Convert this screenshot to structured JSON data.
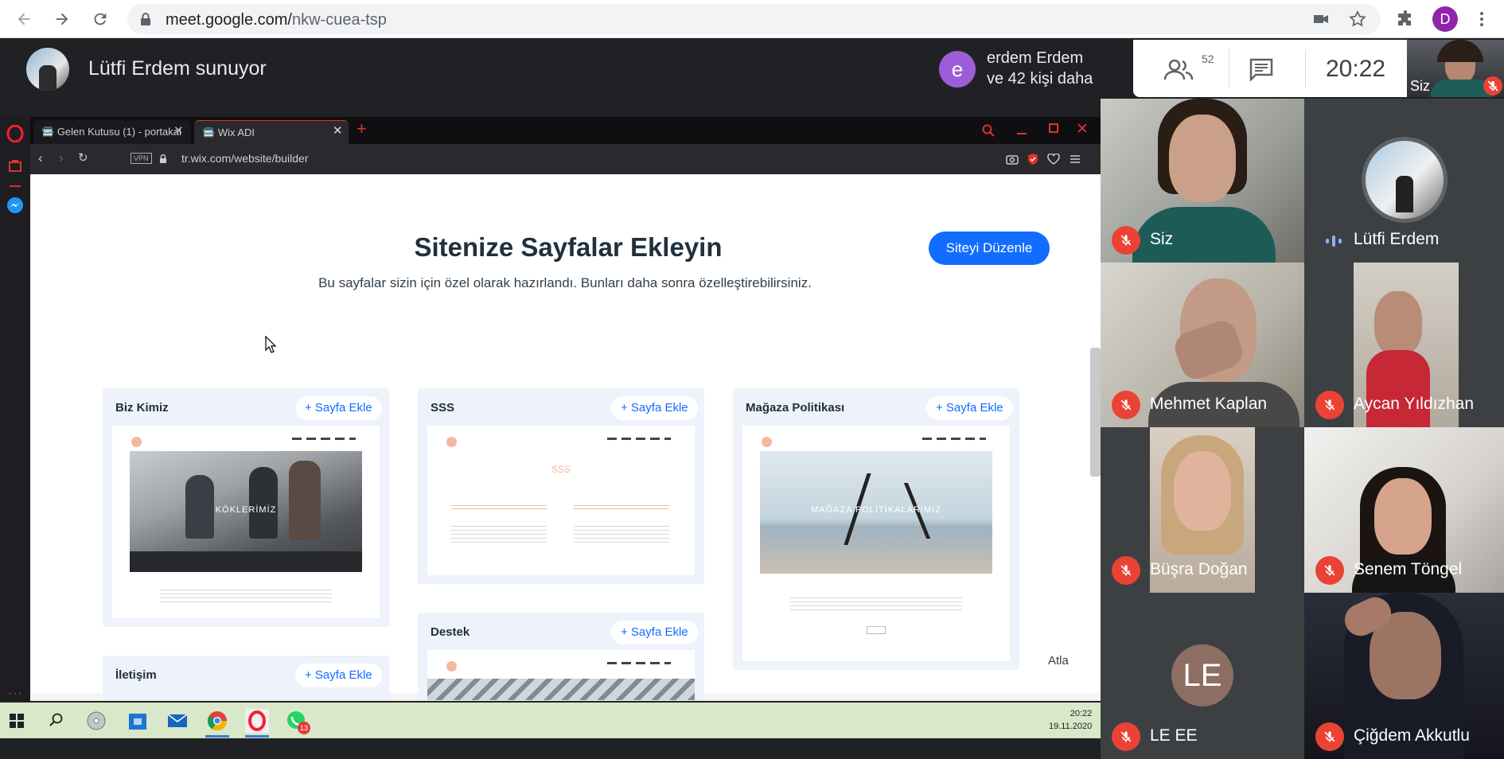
{
  "browser": {
    "url_host": "meet.google.com/",
    "url_path": "nkw-cuea-tsp",
    "profile_initial": "D"
  },
  "meet": {
    "presenter_title": "Lütfi Erdem sunuyor",
    "join_toast": {
      "avatar_letter": "e",
      "line1": "erdem Erdem",
      "line2": "ve 42 kişi daha"
    },
    "people_count": "52",
    "clock": "20:22",
    "self_thumb_label": "Siz",
    "accent_red": "#ea4335",
    "accent_green": "#34a853"
  },
  "opera": {
    "tabs": [
      {
        "label": "Gelen Kutusu (1) - portakal"
      },
      {
        "label": "Wix ADI"
      }
    ],
    "vpn_badge": "VPN",
    "address": "tr.wix.com/website/builder"
  },
  "wix": {
    "title": "Sitenize Sayfalar Ekleyin",
    "subtitle": "Bu sayfalar sizin için özel olarak hazırlandı. Bunları daha sonra özelleştirebilirsiniz.",
    "edit_button": "Siteyi Düzenle",
    "skip_link": "Atla",
    "add_label": "+ Sayfa Ekle",
    "brand_color": "#116dff",
    "cards": [
      {
        "title": "Biz Kimiz",
        "hero_text": "KÖKLERİMİZ"
      },
      {
        "title": "SSS",
        "hero_text": "SSS"
      },
      {
        "title": "Mağaza Politikası",
        "hero_text": "MAĞAZA POLİTİKALARIMIZ"
      },
      {
        "title": "Destek"
      },
      {
        "title": "İletişim"
      }
    ]
  },
  "taskbar": {
    "time": "20:22",
    "date": "19.11.2020",
    "badge_count": "13"
  },
  "participants": [
    {
      "name": "Siz",
      "muted": true
    },
    {
      "name": "Lütfi Erdem",
      "muted": false
    },
    {
      "name": "Mehmet Kaplan",
      "muted": true
    },
    {
      "name": "Aycan Yıldızhan",
      "muted": true
    },
    {
      "name": "Büşra Doğan",
      "muted": true
    },
    {
      "name": "Senem Töngel",
      "muted": true
    },
    {
      "name": "LE EE",
      "muted": true,
      "initials": "LE"
    },
    {
      "name": "Çiğdem Akkutlu",
      "muted": true
    }
  ]
}
